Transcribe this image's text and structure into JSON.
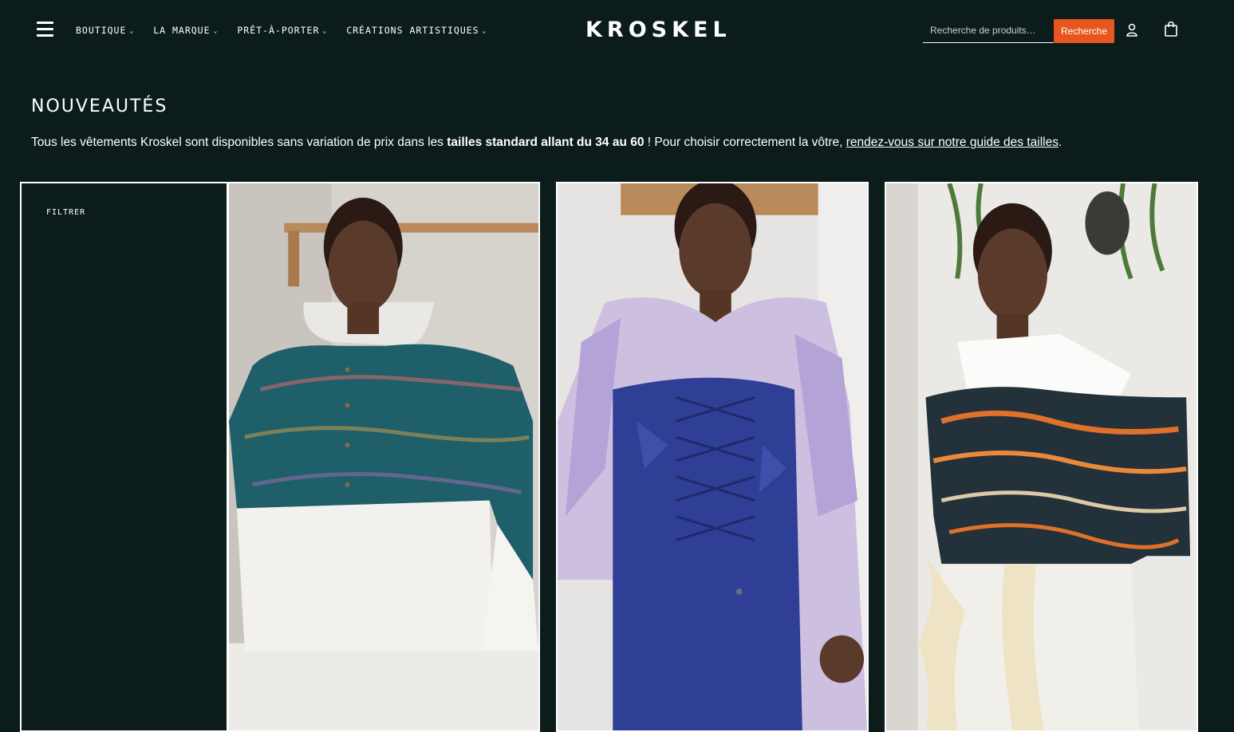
{
  "header": {
    "menu_icon": "hamburger-icon",
    "nav": [
      {
        "label": "BOUTIQUE",
        "chevron": "⌄"
      },
      {
        "label": "LA MARQUE",
        "chevron": "⌄"
      },
      {
        "label": "PRÊT-À-PORTER",
        "chevron": "⌄"
      },
      {
        "label": "CRÉATIONS ARTISTIQUES",
        "chevron": "⌄"
      }
    ],
    "logo": "KROSKEL",
    "search_placeholder": "Recherche de produits…",
    "search_button": "Recherche",
    "user_icon": "user-icon",
    "cart_icon": "shopping-bag-icon"
  },
  "main": {
    "title": "NOUVEAUTÉS",
    "intro_start": "Tous les vêtements Kroskel sont disponibles sans variation de prix dans les ",
    "intro_bold": "tailles standard allant du 34 au 60",
    "intro_mid": " ! Pour choisir correctement la vôtre, ",
    "intro_link": "rendez-vous sur notre guide des tailles",
    "intro_end": ".",
    "filter_label": "FILTRER",
    "filter_chevron": "›"
  },
  "colors": {
    "background": "#0b1c1b",
    "accent": "#e8561f",
    "text": "#ffffff"
  }
}
